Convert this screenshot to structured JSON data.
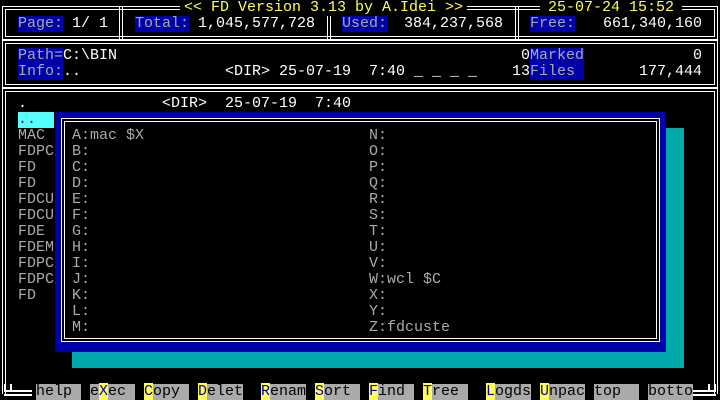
{
  "title": "<< FD Version 3.13 by A.Idei >>",
  "datetime": "25-07-24 15:52",
  "header": {
    "page_label": "Page:",
    "page_value": "1/ 1",
    "total_label": "Total:",
    "total_value": "1,045,577,728",
    "used_label": "Used:",
    "used_value": "384,237,568",
    "free_label": "Free:",
    "free_value": "661,340,160"
  },
  "info": {
    "path_label": "Path=",
    "path_value": "C:\\BIN",
    "marked_count": "0",
    "marked_label": "Marked",
    "marked_size": "0",
    "info_label": "Info:",
    "info_name": "..",
    "info_detail": "<DIR> 25-07-19  7:40 _ _ _ _",
    "files_count": "13",
    "files_label": "Files",
    "files_size": "177,444"
  },
  "files": [
    {
      "name": ".",
      "detail": "<DIR>  25-07-19  7:40"
    },
    {
      "name": "..",
      "detail": ""
    },
    {
      "name": "MAC"
    },
    {
      "name": "FDPC"
    },
    {
      "name": "FD"
    },
    {
      "name": "FD"
    },
    {
      "name": "FDCU"
    },
    {
      "name": "FDCU"
    },
    {
      "name": "FDE"
    },
    {
      "name": "FDEM"
    },
    {
      "name": "FDPC"
    },
    {
      "name": "FDPC"
    },
    {
      "name": "FD"
    }
  ],
  "macros_left": [
    "A:mac $X",
    "B:",
    "C:",
    "D:",
    "E:",
    "F:",
    "G:",
    "H:",
    "I:",
    "J:",
    "K:",
    "L:",
    "M:"
  ],
  "macros_right": [
    "N:",
    "O:",
    "P:",
    "Q:",
    "R:",
    "S:",
    "T:",
    "U:",
    "V:",
    "W:wcl $C",
    "X:",
    "Y:",
    "Z:fdcuste"
  ],
  "fkeys": [
    {
      "pre": "",
      "key": "",
      "rest": "help"
    },
    {
      "pre": "e",
      "key": "X",
      "rest": "ec"
    },
    {
      "pre": "",
      "key": "C",
      "rest": "opy"
    },
    {
      "pre": "",
      "key": "D",
      "rest": "elet"
    },
    {
      "pre": "",
      "key": "R",
      "rest": "enam"
    },
    {
      "pre": "",
      "key": "S",
      "rest": "ort"
    },
    {
      "pre": "",
      "key": "F",
      "rest": "ind"
    },
    {
      "pre": "",
      "key": "T",
      "rest": "ree"
    },
    {
      "pre": "",
      "key": "L",
      "rest": "ogds"
    },
    {
      "pre": "",
      "key": "U",
      "rest": "npac"
    },
    {
      "pre": "",
      "key": "",
      "rest": "top"
    },
    {
      "pre": "",
      "key": "",
      "rest": "botto"
    }
  ],
  "colors": {
    "label_bg": "#0000aa",
    "highlight": "#55ffff",
    "shadow": "#00aaaa",
    "title": "#ffff55"
  }
}
